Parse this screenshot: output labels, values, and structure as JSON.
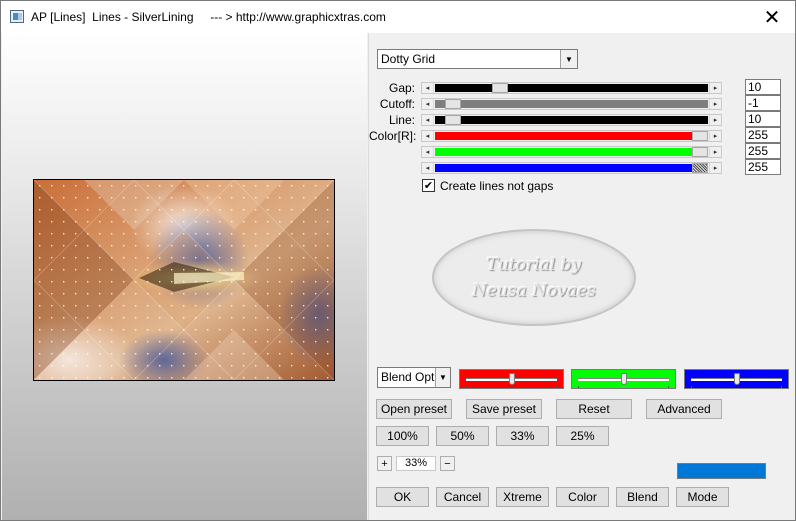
{
  "window": {
    "title": "AP [Lines]  Lines - SilverLining     --- > http://www.graphicxtras.com",
    "close_glyph": "✕"
  },
  "style_dropdown": {
    "value": "Dotty Grid"
  },
  "params": {
    "gap": {
      "label": "Gap:",
      "value": "10",
      "level": 0.22
    },
    "cutoff": {
      "label": "Cutoff:",
      "value": "-1",
      "level": 0.04
    },
    "line": {
      "label": "Line:",
      "value": "10",
      "level": 0.04
    },
    "color_r": {
      "label": "Color[R]:",
      "value": "255",
      "level": 1.0,
      "color": "#ff0000"
    },
    "color_g": {
      "value": "255",
      "level": 1.0,
      "color": "#00ff00"
    },
    "color_b": {
      "value": "255",
      "level": 1.0,
      "color": "#0000ff"
    }
  },
  "checkbox": {
    "label": "Create lines not gaps",
    "checked": true,
    "mark": "✔"
  },
  "watermark": {
    "line1": "Tutorial by",
    "line2": "Neusa Novaes"
  },
  "blend_dropdown": {
    "value": "Blend Optio"
  },
  "color_boxes": [
    {
      "color": "#ff0000",
      "level": 0.5
    },
    {
      "color": "#00ff00",
      "level": 0.5
    },
    {
      "color": "#0000ff",
      "level": 0.5
    }
  ],
  "preset_buttons": {
    "open": "Open preset",
    "save": "Save preset",
    "reset": "Reset",
    "advanced": "Advanced"
  },
  "zoom_presets": [
    "100%",
    "50%",
    "33%",
    "25%"
  ],
  "zoom": {
    "plus": "+",
    "minus": "−",
    "value": "33%"
  },
  "swatch_color": "#0078d7",
  "bottom_buttons": {
    "ok": "OK",
    "cancel": "Cancel",
    "xtreme": "Xtreme",
    "color": "Color",
    "blend": "Blend",
    "mode": "Mode"
  }
}
